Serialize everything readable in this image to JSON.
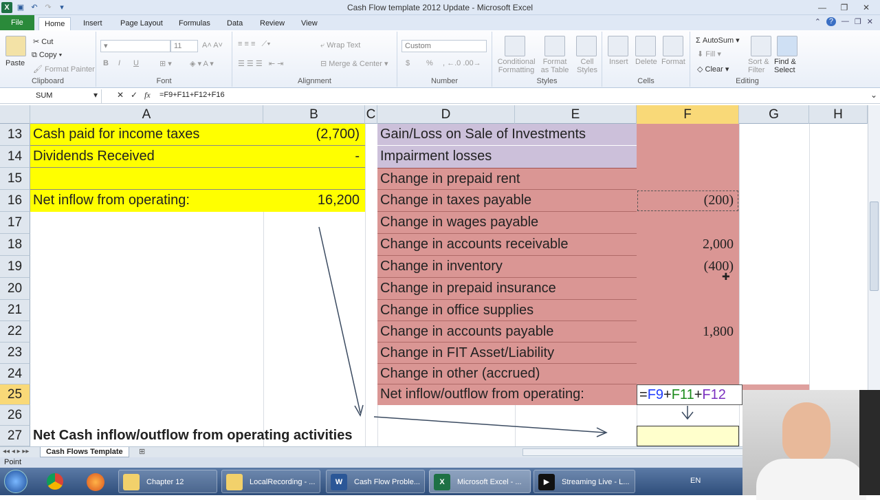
{
  "window": {
    "title": "Cash Flow template 2012 Update  -  Microsoft Excel"
  },
  "tabs": [
    "File",
    "Home",
    "Insert",
    "Page Layout",
    "Formulas",
    "Data",
    "Review",
    "View"
  ],
  "ribbon": {
    "clipboard": {
      "label": "Clipboard",
      "paste": "Paste",
      "cut": "Cut",
      "copy": "Copy",
      "format_painter": "Format Painter"
    },
    "font": {
      "label": "Font",
      "size": "11",
      "bold": "B",
      "italic": "I",
      "underline": "U"
    },
    "alignment": {
      "label": "Alignment",
      "wrap": "Wrap Text",
      "merge": "Merge & Center"
    },
    "number": {
      "label": "Number",
      "format": "Custom",
      "currency": "$",
      "percent": "%"
    },
    "styles": {
      "label": "Styles",
      "conditional": [
        "Conditional",
        "Formatting"
      ],
      "format_table": [
        "Format",
        "as Table"
      ],
      "cell_styles": [
        "Cell",
        "Styles"
      ]
    },
    "cells": {
      "label": "Cells",
      "insert": "Insert",
      "delete": "Delete",
      "format": "Format"
    },
    "editing": {
      "label": "Editing",
      "autosum": "AutoSum",
      "fill": "Fill",
      "clear": "Clear",
      "sort": [
        "Sort &",
        "Filter"
      ],
      "find": [
        "Find &",
        "Select"
      ]
    }
  },
  "formula_bar": {
    "name_box": "SUM",
    "formula": "=F9+F11+F12+F16",
    "fx": "fx"
  },
  "columns": [
    "A",
    "B",
    "C",
    "D",
    "E",
    "F",
    "G",
    "H"
  ],
  "rows": [
    "13",
    "14",
    "15",
    "16",
    "17",
    "18",
    "19",
    "20",
    "21",
    "22",
    "23",
    "24",
    "25",
    "26",
    "27"
  ],
  "left_table": [
    {
      "label": "Cash paid for income taxes",
      "value": "(2,700)"
    },
    {
      "label": "Dividends Received",
      "value": "-"
    },
    {
      "label": "",
      "value": ""
    },
    {
      "label": "Net inflow from operating:",
      "value": "16,200"
    }
  ],
  "right_table": [
    {
      "label": "Gain/Loss on Sale of Investments",
      "value": ""
    },
    {
      "label": "Impairment losses",
      "value": ""
    },
    {
      "label": "Change in prepaid rent",
      "value": ""
    },
    {
      "label": "Change in taxes payable",
      "value": "(200)"
    },
    {
      "label": "Change in wages payable",
      "value": ""
    },
    {
      "label": "Change in accounts receivable",
      "value": "2,000"
    },
    {
      "label": "Change in inventory",
      "value": "(400)"
    },
    {
      "label": "Change in prepaid insurance",
      "value": ""
    },
    {
      "label": "Change in office supplies",
      "value": ""
    },
    {
      "label": "Change in accounts payable",
      "value": "1,800"
    },
    {
      "label": "Change in FIT Asset/Liability",
      "value": ""
    },
    {
      "label": "Change in other (accrued)",
      "value": ""
    }
  ],
  "row25": {
    "label": "Net inflow/outflow from operating:",
    "formula_parts": [
      "=",
      "F9",
      "+",
      "F11",
      "+",
      "F12"
    ]
  },
  "row27": {
    "label": "Net Cash inflow/outflow from operating activities"
  },
  "sheet_tab": "Cash Flows Template",
  "status": "Point",
  "taskbar": [
    {
      "label": "Chapter 12"
    },
    {
      "label": "LocalRecording - ..."
    },
    {
      "label": "Cash Flow Proble..."
    },
    {
      "label": "Microsoft Excel - ..."
    },
    {
      "label": "Streaming Live - L..."
    }
  ],
  "tray": {
    "lang": "EN"
  },
  "colors": {
    "yellow": "#ffff00",
    "lavender": "#ccc0da",
    "pink": "#da9694",
    "formula_blue": "#1f3cff",
    "formula_green": "#1a8a1a",
    "formula_purple": "#7a2fbf"
  }
}
